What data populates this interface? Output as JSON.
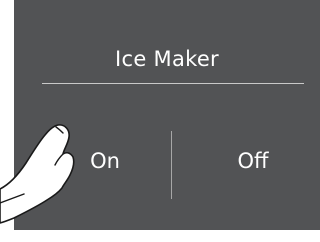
{
  "panel": {
    "title": "Ice Maker",
    "options": [
      {
        "label": "On"
      },
      {
        "label": "Off"
      }
    ]
  },
  "colors": {
    "panel_background": "#525355",
    "text": "#ffffff",
    "divider": "#c9c9c9"
  },
  "icons": {
    "pointer": "pointing-finger-icon"
  }
}
